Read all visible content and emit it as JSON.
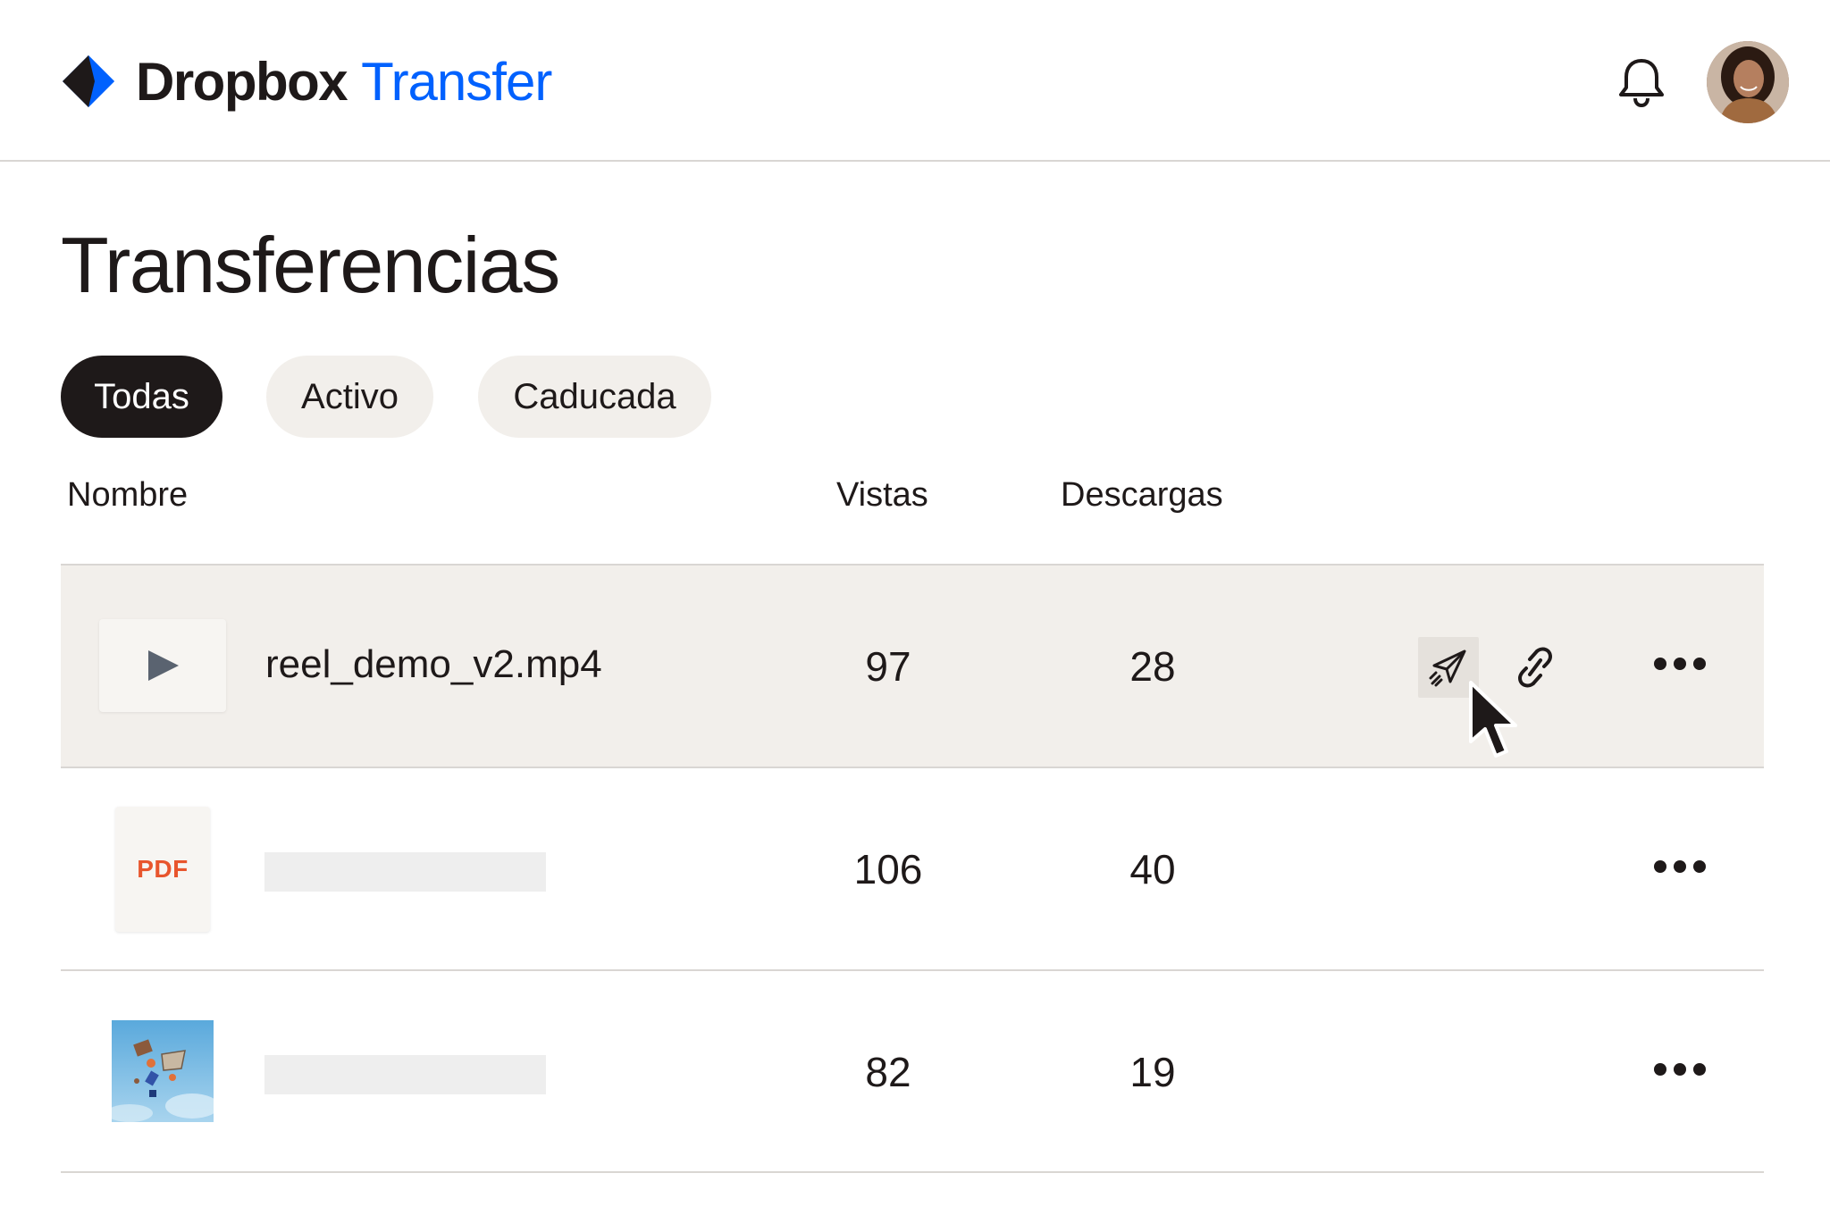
{
  "header": {
    "brand_name": "Dropbox",
    "brand_product": "Transfer",
    "brand_color": "#0061fe",
    "icons": {
      "logo": "dropbox-logo-icon",
      "notifications": "bell-icon",
      "avatar": "user-avatar"
    }
  },
  "page": {
    "title": "Transferencias"
  },
  "filters": {
    "all": "Todas",
    "active": "Activo",
    "expired": "Caducada",
    "selected": "Todas"
  },
  "table": {
    "columns": {
      "name": "Nombre",
      "views": "Vistas",
      "downloads": "Descargas"
    },
    "rows": [
      {
        "type": "video",
        "name": "reel_demo_v2.mp4",
        "views": "97",
        "downloads": "28",
        "hovered": true
      },
      {
        "type": "pdf",
        "type_label": "PDF",
        "name": "",
        "views": "106",
        "downloads": "40"
      },
      {
        "type": "image",
        "name": "",
        "views": "82",
        "downloads": "19"
      }
    ],
    "row_actions": {
      "send": "send-icon",
      "copy_link": "link-icon",
      "more": "more-options-icon"
    }
  },
  "colors": {
    "accent": "#0061fe",
    "text": "#1e1919",
    "hover_bg": "#f2efeb",
    "pdf": "#e8552d"
  }
}
